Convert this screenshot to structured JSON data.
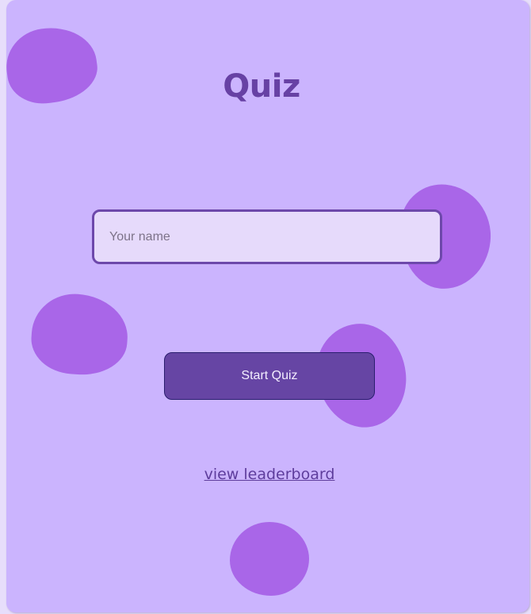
{
  "page": {
    "title": "Quiz"
  },
  "form": {
    "name_placeholder": "Your name",
    "name_value": "",
    "start_label": "Start Quiz",
    "leaderboard_label": "view leaderboard"
  },
  "colors": {
    "page_background": "#e7defb",
    "card_background": "#cbb4fe",
    "blob": "#a966e8",
    "accent": "#6645a4",
    "title_text": "#6741a4",
    "input_background": "#e6dafb"
  }
}
